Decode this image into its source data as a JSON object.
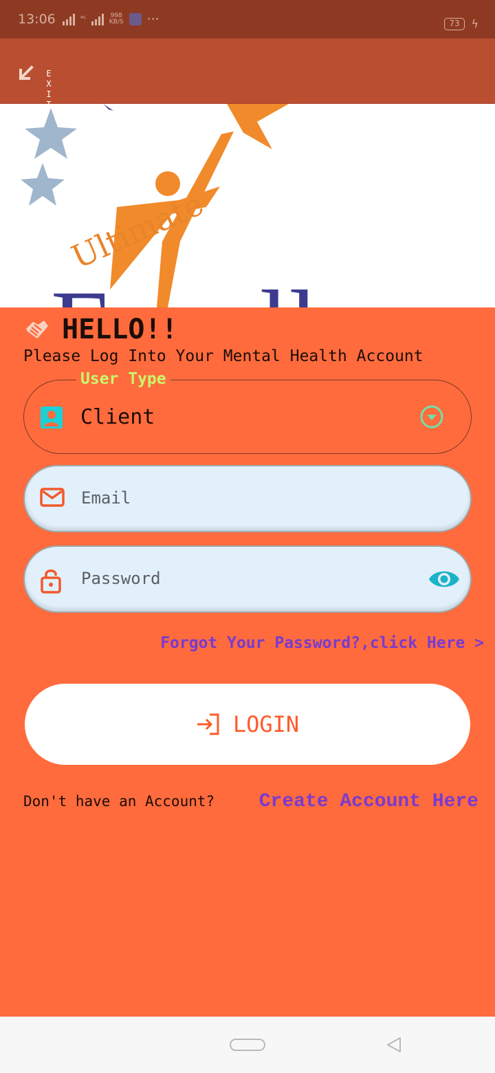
{
  "status_bar": {
    "time": "13:06",
    "network_small": "⁴ᴳ",
    "speed_value": "998",
    "speed_unit": "KB/S",
    "more": "···",
    "battery": "73"
  },
  "topbar": {
    "exit_label": "EXIT"
  },
  "logo": {
    "top_text": "Ultimate",
    "main_text": "Excellence",
    "colors": {
      "top": "#e8842a",
      "main": "#3d3b8f",
      "star_orange": "#f08a2b",
      "star_blue": "#9fb6cc"
    }
  },
  "greeting": {
    "title": "HELLO!!",
    "subtitle": "Please Log Into Your Mental Health Account"
  },
  "user_type": {
    "legend": "User Type",
    "value": "Client"
  },
  "email": {
    "placeholder": "Email"
  },
  "password": {
    "placeholder": "Password"
  },
  "forgot_link": "Forgot Your Password?,click Here >",
  "login_button": "LOGIN",
  "footer": {
    "no_account": "Don't have an Account?",
    "create_link": "Create Account Here"
  },
  "colors": {
    "background": "#ff6b3d",
    "accent_link": "#7a3ad0",
    "legend": "#c9f56b",
    "field_bg": "#e2f0fb",
    "icon_teal": "#1bb3c6"
  }
}
